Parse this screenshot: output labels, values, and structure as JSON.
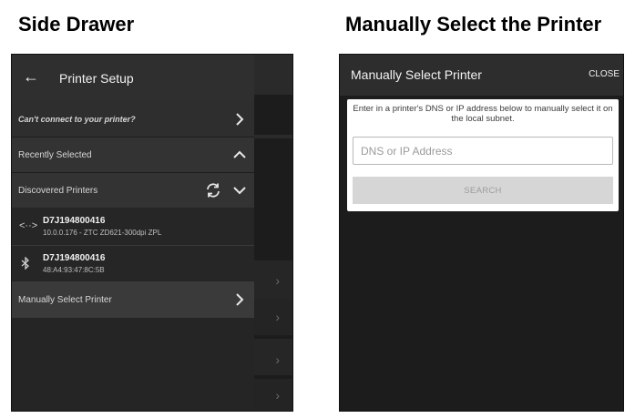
{
  "captions": {
    "left": "Side Drawer",
    "right": "Manually Select the Printer"
  },
  "side_drawer": {
    "header": {
      "back_icon": "arrow-left-icon",
      "title": "Printer Setup"
    },
    "cant_connect": "Can't connect to your printer?",
    "recently_selected": "Recently Selected",
    "discovered_printers": "Discovered Printers",
    "printers": [
      {
        "icon": "network-icon",
        "name": "D7J194800416",
        "detail": "10.0.0.176 - ZTC ZD621-300dpi ZPL"
      },
      {
        "icon": "bluetooth-icon",
        "name": "D7J194800416",
        "detail": "48:A4:93:47:8C:5B"
      }
    ],
    "manually_select": "Manually Select Printer"
  },
  "manual_select": {
    "title": "Manually Select Printer",
    "close_label": "CLOSE",
    "instructions": "Enter in a printer's DNS or IP address below to manually select it on the local subnet.",
    "input_placeholder": "DNS or IP Address",
    "input_value": "",
    "search_label": "SEARCH"
  },
  "colors": {
    "drawer_bg": "#252525",
    "app_bg": "#1c1c1c",
    "card_bg": "#ffffff",
    "disabled_button": "#d6d6d6"
  }
}
